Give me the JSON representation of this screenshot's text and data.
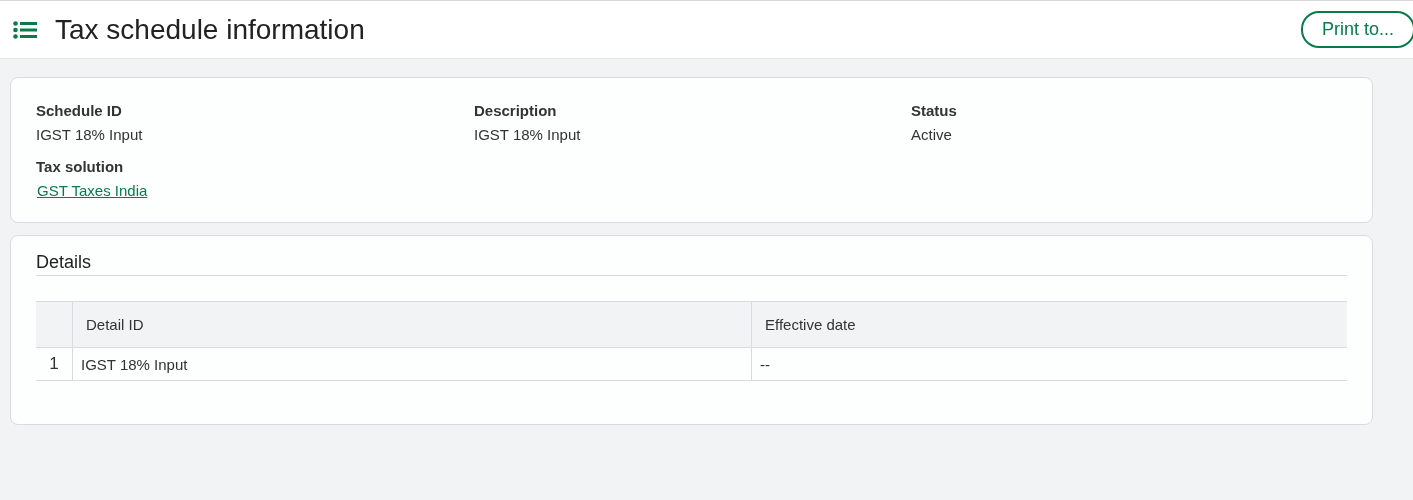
{
  "header": {
    "title": "Tax schedule information",
    "print_button": "Print to..."
  },
  "summary": {
    "fields": [
      {
        "label": "Schedule ID",
        "value": "IGST 18% Input",
        "kind": "text"
      },
      {
        "label": "Description",
        "value": "IGST 18% Input",
        "kind": "text"
      },
      {
        "label": "Status",
        "value": "Active",
        "kind": "text"
      },
      {
        "label": "Tax solution",
        "value": "GST Taxes India",
        "kind": "link"
      }
    ]
  },
  "details": {
    "title": "Details",
    "table": {
      "columns": [
        "Detail ID",
        "Effective date"
      ],
      "rows": [
        {
          "number": "1",
          "cells": [
            "IGST 18% Input",
            "--"
          ]
        }
      ]
    }
  }
}
